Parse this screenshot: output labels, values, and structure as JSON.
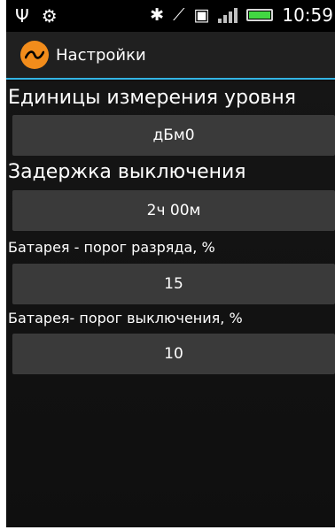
{
  "status_bar": {
    "left_icons": [
      "usb-icon",
      "android-debug-icon"
    ],
    "right_icons": [
      "bluetooth-icon",
      "gps-off-icon",
      "notification-icon",
      "signal-icon",
      "battery-icon"
    ],
    "time": "10:59"
  },
  "action_bar": {
    "title": "Настройки",
    "logo_icon": "sine-wave-icon",
    "accent": "#33b5e5",
    "logo_color": "#f28c1b"
  },
  "settings": [
    {
      "label": "Единицы измерения уровня",
      "value": "дБм0"
    },
    {
      "label": "Задержка выключения",
      "value": "2ч 00м"
    },
    {
      "label": "Батарея - порог разряда, %",
      "value": "15"
    },
    {
      "label": "Батарея- порог выключения, %",
      "value": "10"
    }
  ]
}
